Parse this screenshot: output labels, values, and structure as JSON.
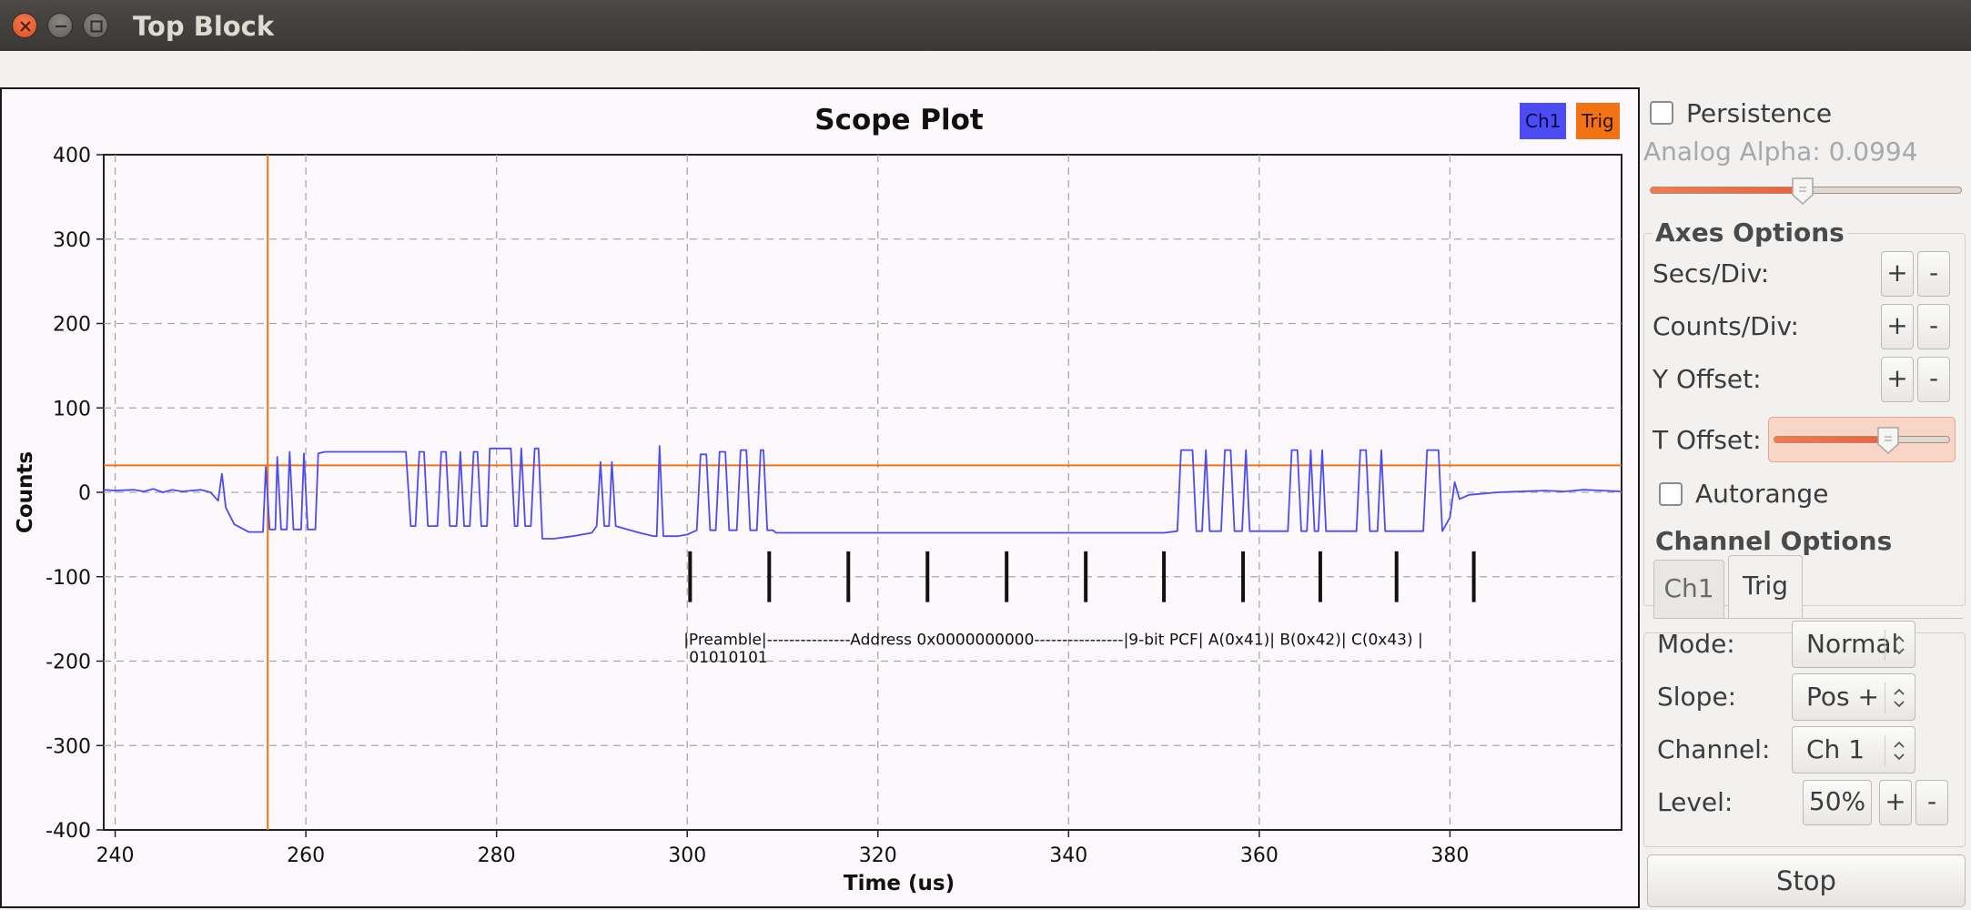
{
  "window": {
    "title": "Top Block"
  },
  "chart_data": {
    "type": "line",
    "title": "Scope Plot",
    "xlabel": "Time (us)",
    "ylabel": "Counts",
    "xlim": [
      238.8,
      398
    ],
    "ylim": [
      -400,
      400
    ],
    "x_ticks": [
      240,
      260,
      280,
      300,
      320,
      340,
      360,
      380
    ],
    "y_ticks": [
      400,
      300,
      200,
      100,
      0,
      -100,
      -200,
      -300,
      -400
    ],
    "grid": true,
    "legend_position": "top-right",
    "series": [
      {
        "name": "Ch1",
        "color": "#4c4cf5",
        "points": [
          [
            238.8,
            3
          ],
          [
            240,
            2
          ],
          [
            242,
            3
          ],
          [
            243,
            1
          ],
          [
            244,
            4
          ],
          [
            245,
            0
          ],
          [
            246,
            3
          ],
          [
            247,
            1
          ],
          [
            248,
            2
          ],
          [
            249,
            3
          ],
          [
            250,
            0
          ],
          [
            250.8,
            -10
          ],
          [
            251.2,
            22
          ],
          [
            251.6,
            -18
          ],
          [
            252.5,
            -38
          ],
          [
            254,
            -47
          ],
          [
            255.5,
            -47
          ],
          [
            255.8,
            30
          ],
          [
            256.2,
            -44
          ],
          [
            256.8,
            -44
          ],
          [
            257,
            42
          ],
          [
            257.4,
            -44
          ],
          [
            258,
            -44
          ],
          [
            258.3,
            48
          ],
          [
            258.7,
            -44
          ],
          [
            259.5,
            -44
          ],
          [
            259.8,
            46
          ],
          [
            260.2,
            -44
          ],
          [
            261,
            -44
          ],
          [
            261.3,
            46
          ],
          [
            262,
            48
          ],
          [
            266,
            48
          ],
          [
            270,
            48
          ],
          [
            270.5,
            48
          ],
          [
            271,
            -40
          ],
          [
            271.5,
            -40
          ],
          [
            271.9,
            48
          ],
          [
            272.4,
            48
          ],
          [
            272.8,
            -40
          ],
          [
            273.8,
            -40
          ],
          [
            274.2,
            48
          ],
          [
            274.7,
            48
          ],
          [
            275.1,
            -40
          ],
          [
            275.8,
            -40
          ],
          [
            276.2,
            48
          ],
          [
            276.6,
            -40
          ],
          [
            277.2,
            -40
          ],
          [
            277.6,
            48
          ],
          [
            278,
            48
          ],
          [
            278.4,
            -40
          ],
          [
            279,
            -40
          ],
          [
            279.3,
            52
          ],
          [
            281.5,
            52
          ],
          [
            281.9,
            -40
          ],
          [
            282.2,
            -40
          ],
          [
            282.6,
            52
          ],
          [
            283,
            -40
          ],
          [
            283.6,
            -40
          ],
          [
            284,
            52
          ],
          [
            284.4,
            52
          ],
          [
            284.8,
            -55
          ],
          [
            286,
            -55
          ],
          [
            288,
            -52
          ],
          [
            290,
            -48
          ],
          [
            290.5,
            -40
          ],
          [
            290.9,
            36
          ],
          [
            291.3,
            -40
          ],
          [
            291.8,
            -40
          ],
          [
            292.1,
            36
          ],
          [
            292.5,
            -40
          ],
          [
            295,
            -48
          ],
          [
            296.5,
            -52
          ],
          [
            296.8,
            -52
          ],
          [
            297.1,
            55
          ],
          [
            297.5,
            -52
          ],
          [
            299,
            -52
          ],
          [
            300,
            -50
          ],
          [
            301,
            -45
          ],
          [
            301.4,
            45
          ],
          [
            302,
            45
          ],
          [
            302.4,
            -45
          ],
          [
            303,
            -45
          ],
          [
            303.4,
            48
          ],
          [
            304,
            48
          ],
          [
            304.4,
            -45
          ],
          [
            305.2,
            -45
          ],
          [
            305.6,
            50
          ],
          [
            306.2,
            50
          ],
          [
            306.6,
            -45
          ],
          [
            307.3,
            -45
          ],
          [
            307.7,
            50
          ],
          [
            308,
            50
          ],
          [
            308.4,
            -45
          ],
          [
            309,
            -45
          ],
          [
            309.3,
            -48
          ],
          [
            312,
            -48
          ],
          [
            320,
            -48
          ],
          [
            330,
            -48
          ],
          [
            340,
            -48
          ],
          [
            350,
            -48
          ],
          [
            351.4,
            -46
          ],
          [
            351.8,
            50
          ],
          [
            353,
            50
          ],
          [
            353.4,
            -46
          ],
          [
            354,
            -46
          ],
          [
            354.4,
            50
          ],
          [
            354.8,
            -46
          ],
          [
            356,
            -46
          ],
          [
            356.4,
            50
          ],
          [
            357,
            50
          ],
          [
            357.4,
            -46
          ],
          [
            358.2,
            -46
          ],
          [
            358.6,
            50
          ],
          [
            359,
            -46
          ],
          [
            363,
            -46
          ],
          [
            363.4,
            50
          ],
          [
            364,
            50
          ],
          [
            364.4,
            -46
          ],
          [
            365,
            -46
          ],
          [
            365.4,
            50
          ],
          [
            365.8,
            -46
          ],
          [
            366.2,
            -46
          ],
          [
            366.6,
            50
          ],
          [
            367,
            -46
          ],
          [
            370.2,
            -46
          ],
          [
            370.6,
            50
          ],
          [
            371.2,
            50
          ],
          [
            371.6,
            -46
          ],
          [
            372.4,
            -46
          ],
          [
            372.8,
            50
          ],
          [
            373.2,
            -46
          ],
          [
            376,
            -46
          ],
          [
            377.2,
            -46
          ],
          [
            377.6,
            50
          ],
          [
            378.8,
            50
          ],
          [
            379.2,
            -46
          ],
          [
            380,
            -30
          ],
          [
            380.5,
            12
          ],
          [
            381,
            -8
          ],
          [
            382,
            -3
          ],
          [
            385,
            0
          ],
          [
            390,
            2
          ],
          [
            392,
            1
          ],
          [
            394,
            3
          ],
          [
            396,
            2
          ],
          [
            398,
            1
          ]
        ]
      },
      {
        "name": "Trig",
        "color": "#f37314",
        "trigger_time": 256,
        "trigger_level": 32
      }
    ],
    "markers_x": [
      300.3,
      308.6,
      316.9,
      325.2,
      333.5,
      341.8,
      350,
      358.3,
      366.4,
      374.4,
      382.5
    ],
    "markers_y": [
      -70,
      -130
    ],
    "annotation": {
      "line1": "|Preamble|---------------Address 0x0000000000----------------|9-bit PCF| A(0x41)| B(0x42)| C(0x43) |",
      "line2": "01010101",
      "x": 300,
      "y1": -172,
      "y2": -195
    }
  },
  "legend": {
    "ch1": "Ch1",
    "trig": "Trig"
  },
  "panel": {
    "persistence_label": "Persistence",
    "persistence_checked": false,
    "analog_alpha_label": "Analog Alpha: 0.0994",
    "alpha_value": 0.0994,
    "alpha_fraction": 0.49,
    "axes_title": "Axes Options",
    "secs_label": "Secs/Div:",
    "counts_label": "Counts/Div:",
    "yoffset_label": "Y Offset:",
    "toffset_label": "T Offset:",
    "toffset_fraction": 0.65,
    "plus": "+",
    "minus": "-",
    "autorange_label": "Autorange",
    "autorange_checked": false,
    "channel_title": "Channel Options",
    "tab_ch1": "Ch1",
    "tab_trig": "Trig",
    "active_tab": "Trig",
    "mode_label": "Mode:",
    "mode_value": "Normal",
    "slope_label": "Slope:",
    "slope_value": "Pos +",
    "channel_label": "Channel:",
    "channel_value": "Ch 1",
    "level_label": "Level:",
    "level_value": "50%",
    "stop_label": "Stop"
  }
}
